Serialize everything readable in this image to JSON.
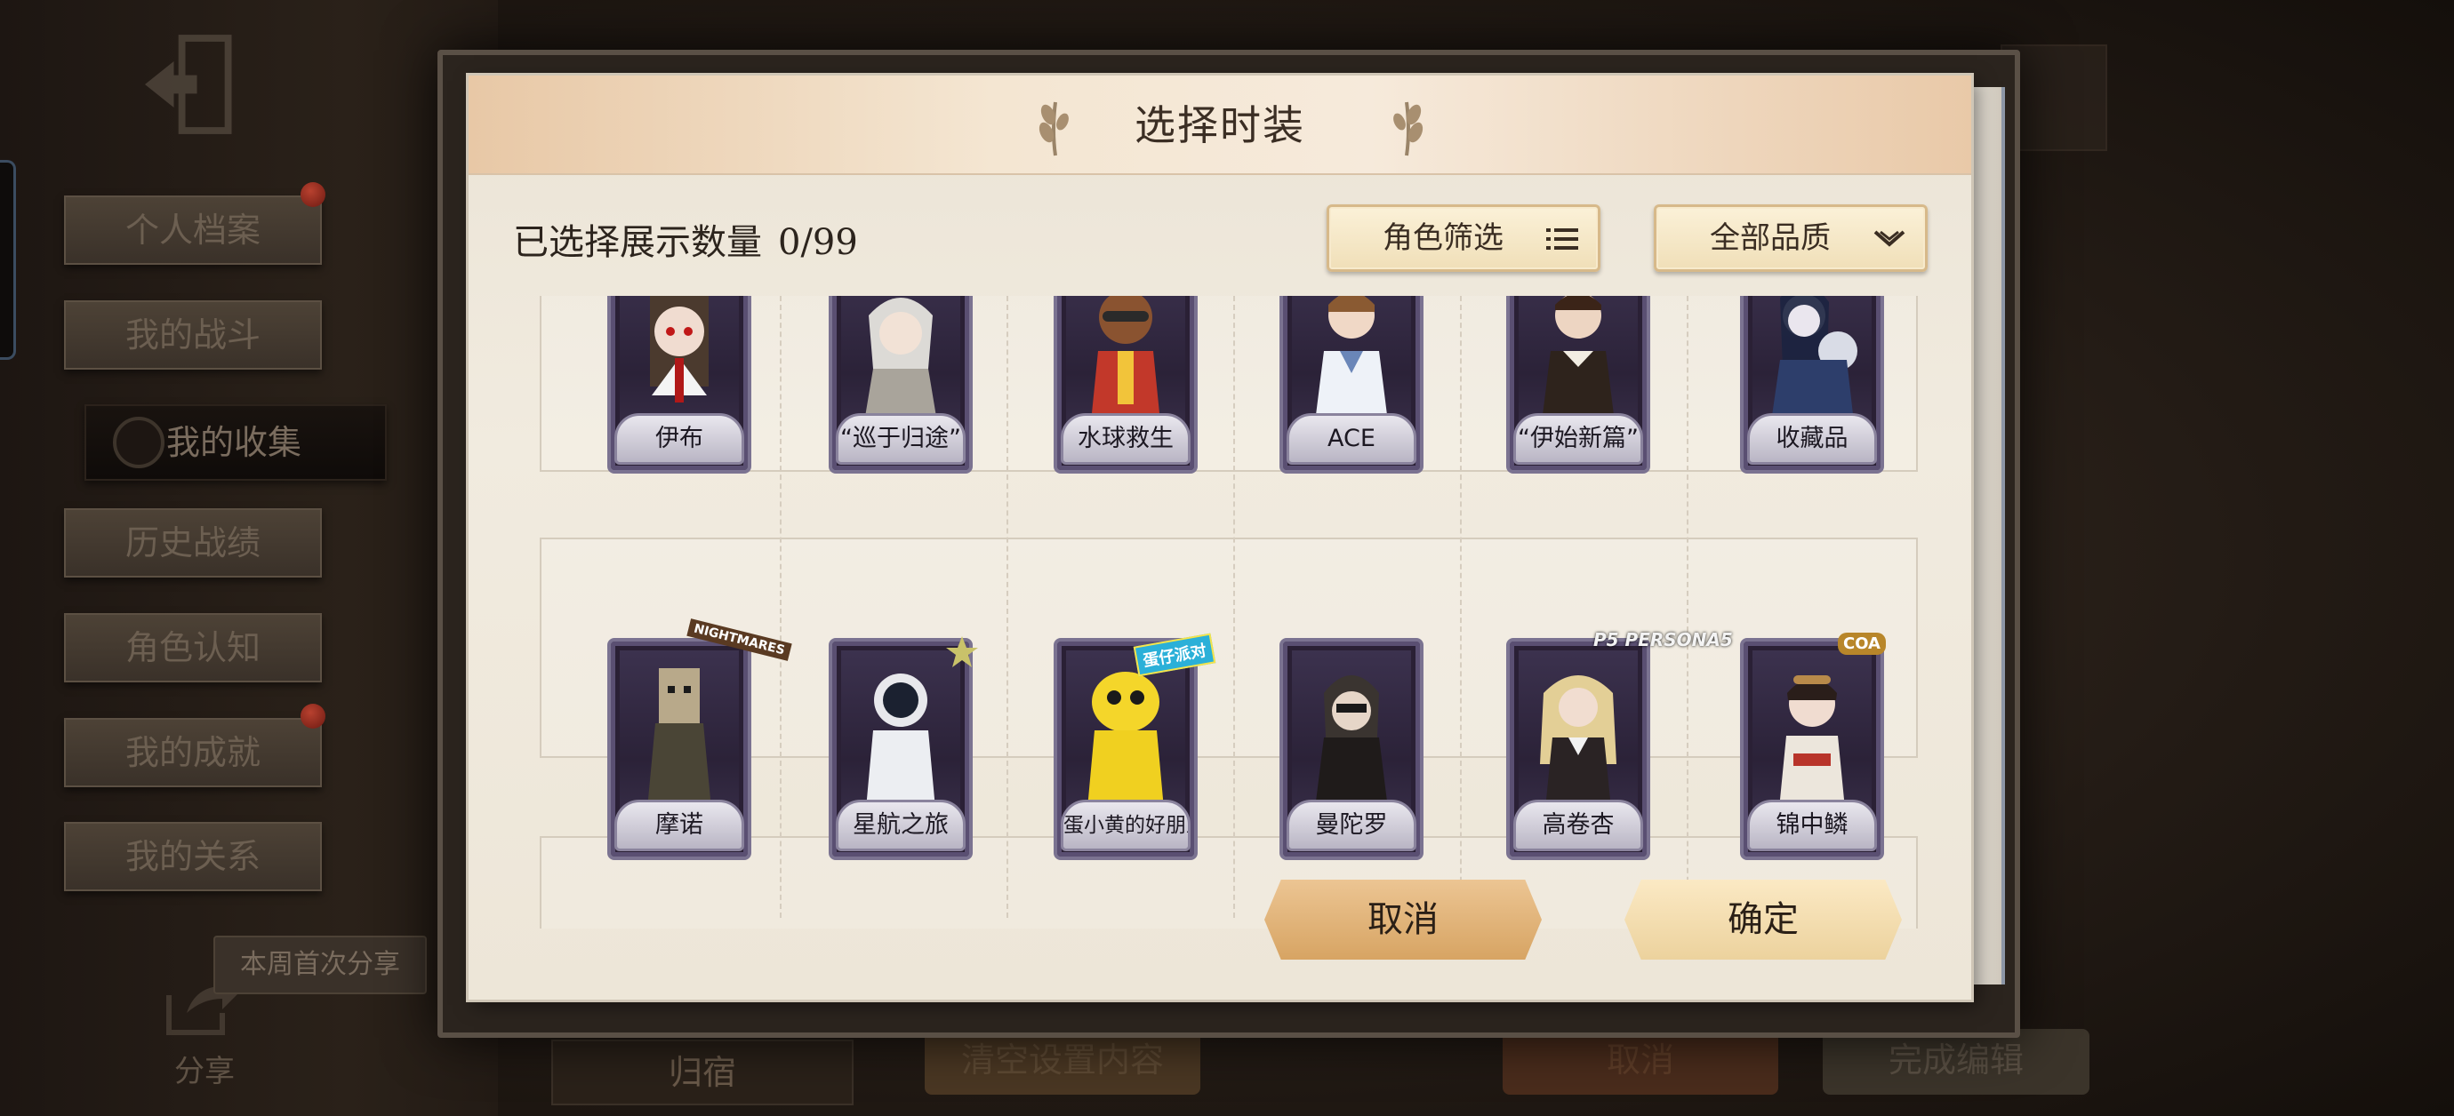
{
  "background": {
    "sidebar": {
      "items": [
        {
          "label": "个人档案",
          "notification": true
        },
        {
          "label": "我的战斗",
          "notification": false
        },
        {
          "label": "我的收集",
          "notification": false,
          "active": true
        },
        {
          "label": "历史战绩",
          "notification": false
        },
        {
          "label": "角色认知",
          "notification": false
        },
        {
          "label": "我的成就",
          "notification": true
        },
        {
          "label": "我的关系",
          "notification": false
        }
      ]
    },
    "share": {
      "tooltip": "本周首次分享",
      "label": "分享"
    },
    "bottom": {
      "home_tab": "归宿",
      "clear_label": "清空设置内容",
      "cancel_label": "取消",
      "done_label": "完成编辑"
    }
  },
  "dialog": {
    "title": "选择时装",
    "selected_label": "已选择展示数量",
    "selected_count": "0/99",
    "role_filter_label": "角色筛选",
    "quality_filter_label": "全部品质",
    "cancel_label": "取消",
    "confirm_label": "确定"
  },
  "costumes": {
    "row1": [
      {
        "name": "伊布"
      },
      {
        "name": "“巡于归途”"
      },
      {
        "name": "水球救生"
      },
      {
        "name": "ACE"
      },
      {
        "name": "“伊始新篇”"
      },
      {
        "name": "收藏品"
      }
    ],
    "row2": [
      {
        "name": "摩诺",
        "badge": "NIGHTMARES"
      },
      {
        "name": "星航之旅"
      },
      {
        "name": "蛋小黄的好朋友",
        "badge": "蛋仔派对"
      },
      {
        "name": "曼陀罗"
      },
      {
        "name": "高卷杏",
        "badge": "P5 PERSONA5"
      },
      {
        "name": "锦中鳞",
        "badge": "COA"
      }
    ]
  },
  "colors": {
    "accent_gold": "#ecd29d",
    "card_purple": "#3d3350",
    "notification_red": "#b8412f"
  }
}
